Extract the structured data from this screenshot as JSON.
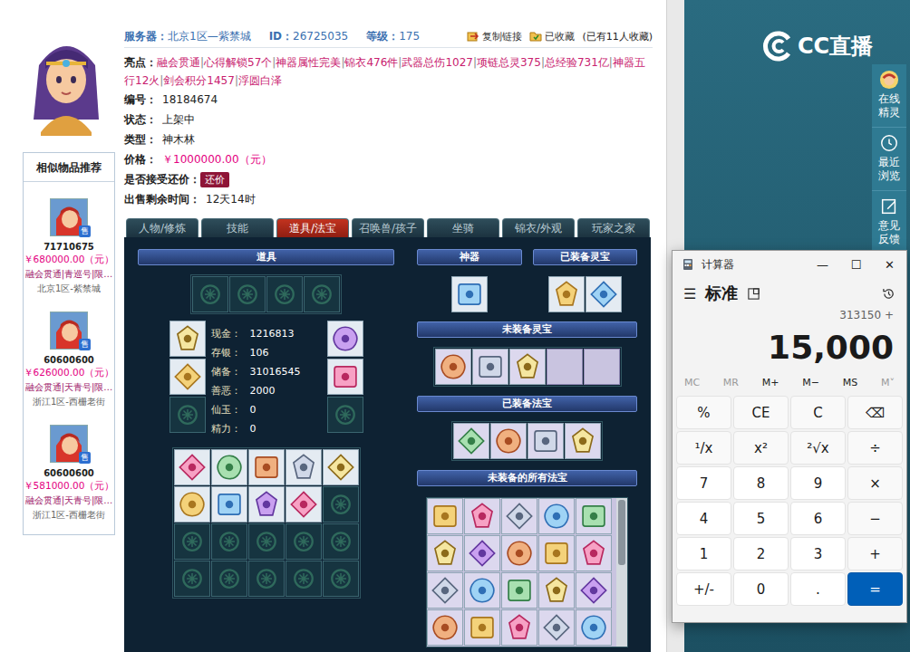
{
  "listing": {
    "server_label": "服务器：",
    "server": "北京1区—紫禁城",
    "id_label": "ID：",
    "id": "26725035",
    "level_label": "等级：",
    "level": "175",
    "copy_link": "复制链接",
    "favorited": "已收藏",
    "favorite_count": "(已有11人收藏)",
    "highlights_label": "亮点：",
    "separator": "|",
    "highlights": [
      "融会贯通",
      "心得解锁57个",
      "神器属性完美",
      "锦衣476件",
      "武器总伤1027",
      "项链总灵375",
      "总经验731亿",
      "神器五行12火",
      "剑会积分1457",
      "浮圆白泽"
    ],
    "fields": [
      {
        "label": "编号：",
        "value": "18184674",
        "kind": "text"
      },
      {
        "label": "状态：",
        "value": "上架中",
        "kind": "text"
      },
      {
        "label": "类型：",
        "value": "神木林",
        "kind": "text"
      },
      {
        "label": "价格：",
        "value": "￥1000000.00（元）",
        "kind": "price"
      },
      {
        "label": "是否接受还价：",
        "value": "还价",
        "kind": "button"
      },
      {
        "label": "出售剩余时间：",
        "value": "12天14时",
        "kind": "text"
      }
    ]
  },
  "tabs": [
    {
      "label": "人物/修炼",
      "selected": false
    },
    {
      "label": "技能",
      "selected": false
    },
    {
      "label": "道具/法宝",
      "selected": true
    },
    {
      "label": "召唤兽/孩子",
      "selected": false
    },
    {
      "label": "坐骑",
      "selected": false
    },
    {
      "label": "锦衣/外观",
      "selected": false
    },
    {
      "label": "玩家之家",
      "selected": false
    }
  ],
  "recommend": {
    "title": "相似物品推荐",
    "items": [
      {
        "id": "71710675",
        "price": "￥680000.00（元）",
        "tags": "融会贯通|青巡号|限…",
        "server": "北京1区-紫禁城",
        "badge": "售"
      },
      {
        "id": "60600600",
        "price": "￥626000.00（元）",
        "tags": "融会贯通|天青号|限…",
        "server": "浙江1区-西栅老街",
        "badge": "售"
      },
      {
        "id": "60600600",
        "price": "￥581000.00（元）",
        "tags": "融会贯通|天青号|限…",
        "server": "浙江1区-西栅老街",
        "badge": "售"
      }
    ]
  },
  "props": {
    "title": "道具",
    "top_slots": [
      {
        "filled": false
      },
      {
        "filled": false
      },
      {
        "filled": false
      },
      {
        "filled": false
      }
    ],
    "equip_left": [
      {
        "filled": true
      },
      {
        "filled": true
      },
      {
        "filled": false
      }
    ],
    "equip_right": [
      {
        "filled": true
      },
      {
        "filled": true
      },
      {
        "filled": false
      }
    ],
    "stats": [
      {
        "label": "现金：",
        "value": "1216813"
      },
      {
        "label": "存银：",
        "value": "106"
      },
      {
        "label": "储备：",
        "value": "31016545"
      },
      {
        "label": "善恶：",
        "value": "2000"
      },
      {
        "label": "仙玉：",
        "value": "0"
      },
      {
        "label": "精力：",
        "value": "0"
      }
    ],
    "bag": [
      {
        "filled": true
      },
      {
        "filled": true
      },
      {
        "filled": true
      },
      {
        "filled": true
      },
      {
        "filled": true
      },
      {
        "filled": true
      },
      {
        "filled": true
      },
      {
        "filled": true
      },
      {
        "filled": true
      },
      {
        "filled": false
      },
      {
        "filled": false
      },
      {
        "filled": false
      },
      {
        "filled": false
      },
      {
        "filled": false
      },
      {
        "filled": false
      },
      {
        "filled": false
      },
      {
        "filled": false
      },
      {
        "filled": false
      },
      {
        "filled": false
      },
      {
        "filled": false
      }
    ]
  },
  "artifact": {
    "title": "神器",
    "slots": [
      {
        "filled": true
      }
    ]
  },
  "equipped_lingbao": {
    "title": "已装备灵宝",
    "slots": [
      {
        "filled": true
      },
      {
        "filled": true
      }
    ]
  },
  "unequipped_lingbao": {
    "title": "未装备灵宝",
    "slots": [
      {
        "filled": true
      },
      {
        "filled": true
      },
      {
        "filled": true
      },
      {
        "filled": false
      },
      {
        "filled": false
      }
    ]
  },
  "equipped_fabao": {
    "title": "已装备法宝",
    "slots": [
      {
        "filled": true
      },
      {
        "filled": true
      },
      {
        "filled": true
      },
      {
        "filled": true
      }
    ]
  },
  "all_fabao": {
    "title": "未装备的所有法宝",
    "scroll_level": 0.45,
    "slots": [
      {
        "filled": true
      },
      {
        "filled": true
      },
      {
        "filled": true
      },
      {
        "filled": true
      },
      {
        "filled": true
      },
      {
        "filled": true
      },
      {
        "filled": true
      },
      {
        "filled": true
      },
      {
        "filled": true
      },
      {
        "filled": true
      },
      {
        "filled": true
      },
      {
        "filled": true
      },
      {
        "filled": true
      },
      {
        "filled": true
      },
      {
        "filled": true
      },
      {
        "filled": true
      },
      {
        "filled": true
      },
      {
        "filled": true
      },
      {
        "filled": true
      },
      {
        "filled": true
      }
    ]
  },
  "right_panel": {
    "logo": "CC直播",
    "side_items": [
      {
        "label": "在线精灵"
      },
      {
        "label": "最近浏览"
      },
      {
        "label": "意见反馈"
      }
    ]
  },
  "calculator": {
    "title": "计算器",
    "window_controls": [
      "—",
      "☐",
      "✕"
    ],
    "menu": "☰",
    "mode": "标准",
    "expression": "313150 +",
    "display": "15,000",
    "memory": [
      {
        "label": "MC",
        "disabled": true
      },
      {
        "label": "MR",
        "disabled": true
      },
      {
        "label": "M+",
        "disabled": false
      },
      {
        "label": "M−",
        "disabled": false
      },
      {
        "label": "MS",
        "disabled": false
      },
      {
        "label": "M˅",
        "disabled": true
      }
    ],
    "keys": [
      {
        "label": "%",
        "kind": "fn"
      },
      {
        "label": "CE",
        "kind": "fn"
      },
      {
        "label": "C",
        "kind": "fn"
      },
      {
        "label": "⌫",
        "kind": "fn"
      },
      {
        "label": "¹/x",
        "kind": "fn"
      },
      {
        "label": "x²",
        "kind": "fn"
      },
      {
        "label": "²√x",
        "kind": "fn"
      },
      {
        "label": "÷",
        "kind": "fn"
      },
      {
        "label": "7",
        "kind": "digit"
      },
      {
        "label": "8",
        "kind": "digit"
      },
      {
        "label": "9",
        "kind": "digit"
      },
      {
        "label": "×",
        "kind": "fn"
      },
      {
        "label": "4",
        "kind": "digit"
      },
      {
        "label": "5",
        "kind": "digit"
      },
      {
        "label": "6",
        "kind": "digit"
      },
      {
        "label": "−",
        "kind": "fn"
      },
      {
        "label": "1",
        "kind": "digit"
      },
      {
        "label": "2",
        "kind": "digit"
      },
      {
        "label": "3",
        "kind": "digit"
      },
      {
        "label": "+",
        "kind": "fn"
      },
      {
        "label": "+/-",
        "kind": "digit"
      },
      {
        "label": "0",
        "kind": "digit"
      },
      {
        "label": ".",
        "kind": "digit"
      },
      {
        "label": "=",
        "kind": "equals"
      }
    ]
  }
}
